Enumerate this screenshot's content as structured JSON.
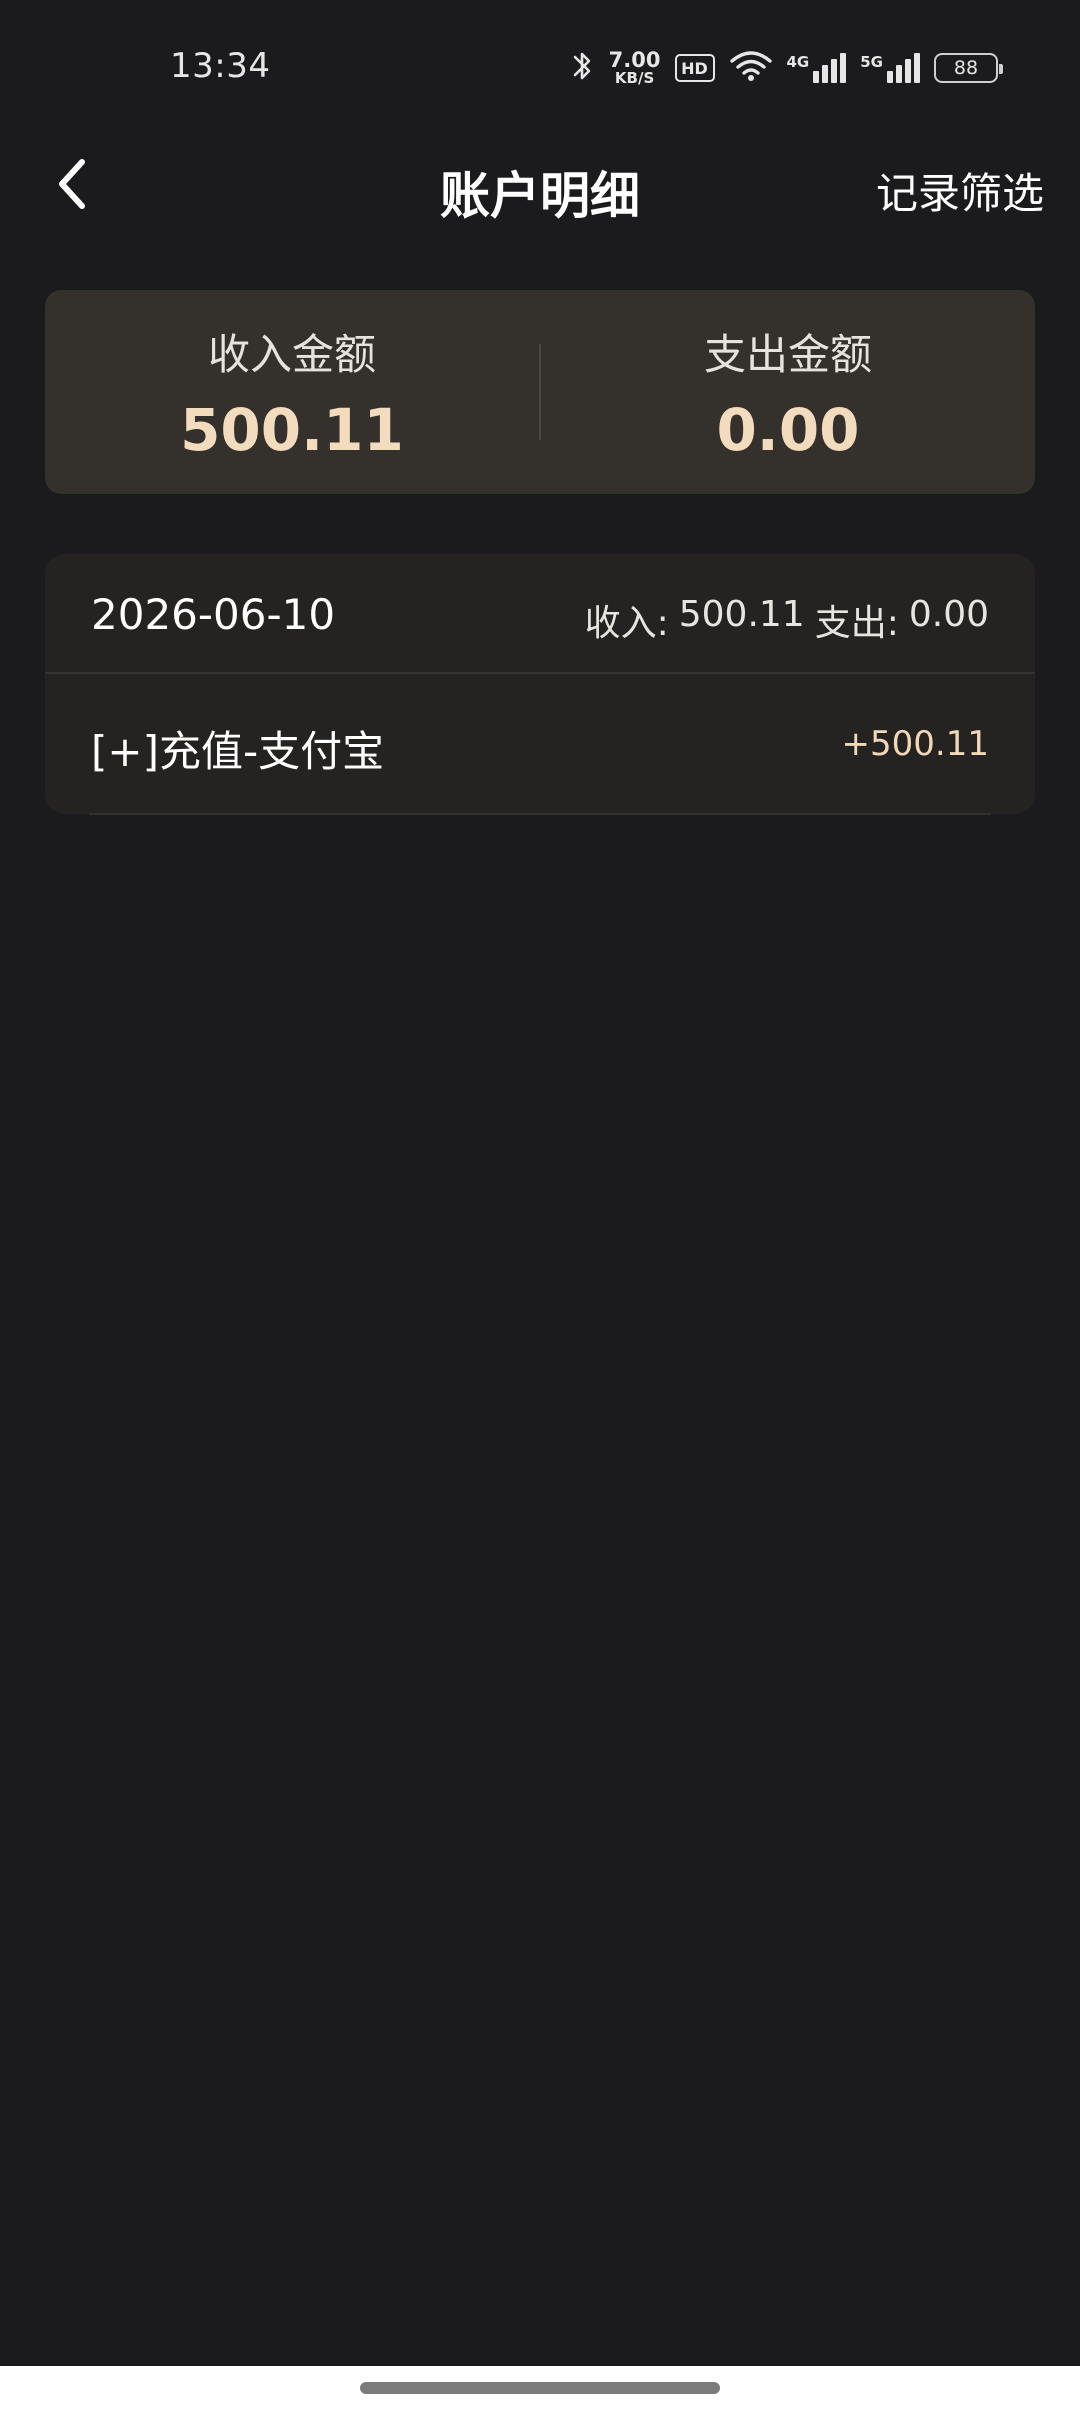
{
  "status_bar": {
    "time": "13:34",
    "net_speed_value": "7.00",
    "net_speed_unit": "KB/S",
    "hd_label": "HD",
    "signal_1_label": "4G",
    "signal_2_label": "5G",
    "battery_level": "88",
    "icons": [
      "bluetooth-icon",
      "hd-icon",
      "wifi-icon",
      "signal-4g-icon",
      "signal-5g-icon",
      "battery-icon"
    ]
  },
  "nav": {
    "back_icon": "chevron-left-icon",
    "title": "账户明细",
    "filter_label": "记录筛选"
  },
  "summary": {
    "income_label": "收入金额",
    "income_value": "500.11",
    "expense_label": "支出金额",
    "expense_value": "0.00"
  },
  "records": [
    {
      "date": "2026-06-10",
      "income_label": "收入:",
      "income_value": "500.11",
      "expense_label": "支出:",
      "expense_value": "0.00",
      "items": [
        {
          "title": "[+]充值-支付宝",
          "amount": "+500.11"
        }
      ]
    }
  ],
  "colors": {
    "background": "#1b1b1d",
    "summary_card": "#34302c",
    "record_card": "#252322",
    "accent_gold": "#f3dbbd"
  }
}
